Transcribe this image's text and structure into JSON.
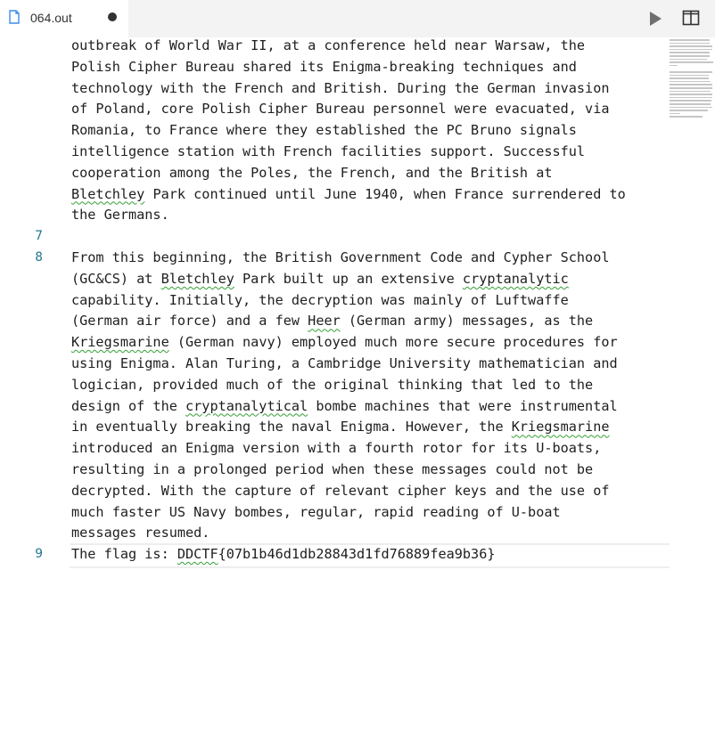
{
  "tab": {
    "filename": "064.out",
    "icon": "file-icon",
    "dirty_icon": "unsaved-dot-icon"
  },
  "toolbar": {
    "run_icon": "play-icon",
    "split_icon": "split-editor-icon"
  },
  "editor": {
    "lines": [
      {
        "number": "",
        "text": "outbreak of World War II, at a conference held near Warsaw, the"
      },
      {
        "number": "",
        "text": "Polish Cipher Bureau shared its Enigma-breaking techniques and"
      },
      {
        "number": "",
        "text": "technology with the French and British. During the German invasion"
      },
      {
        "number": "",
        "text": "of Poland, core Polish Cipher Bureau personnel were evacuated, via"
      },
      {
        "number": "",
        "text": "Romania, to France where they established the PC Bruno signals"
      },
      {
        "number": "",
        "text": "intelligence station with French facilities support. Successful"
      },
      {
        "number": "",
        "text": "cooperation among the Poles, the French, and the British at"
      },
      {
        "number": "",
        "text": "Bletchley Park continued until June 1940, when France surrendered to"
      },
      {
        "number": "",
        "text": "the Germans."
      },
      {
        "number": "7",
        "text": ""
      },
      {
        "number": "8",
        "text": "From this beginning, the British Government Code and Cypher School"
      },
      {
        "number": "",
        "text": "(GC&CS) at Bletchley Park built up an extensive cryptanalytic"
      },
      {
        "number": "",
        "text": "capability. Initially, the decryption was mainly of Luftwaffe"
      },
      {
        "number": "",
        "text": "(German air force) and a few Heer (German army) messages, as the"
      },
      {
        "number": "",
        "text": "Kriegsmarine (German navy) employed much more secure procedures for"
      },
      {
        "number": "",
        "text": "using Enigma. Alan Turing, a Cambridge University mathematician and"
      },
      {
        "number": "",
        "text": "logician, provided much of the original thinking that led to the"
      },
      {
        "number": "",
        "text": "design of the cryptanalytical bombe machines that were instrumental"
      },
      {
        "number": "",
        "text": "in eventually breaking the naval Enigma. However, the Kriegsmarine"
      },
      {
        "number": "",
        "text": "introduced an Enigma version with a fourth rotor for its U-boats,"
      },
      {
        "number": "",
        "text": "resulting in a prolonged period when these messages could not be"
      },
      {
        "number": "",
        "text": "decrypted. With the capture of relevant cipher keys and the use of"
      },
      {
        "number": "",
        "text": "much faster US Navy bombes, regular, rapid reading of U-boat"
      },
      {
        "number": "",
        "text": "messages resumed."
      },
      {
        "number": "9",
        "text": "The flag is: DDCTF{07b1b46d1db28843d1fd76889fea9b36}"
      }
    ],
    "squiggly_words": [
      "Bletchley",
      "cryptanalytic",
      "Heer",
      "Kriegsmarine",
      "cryptanalytical",
      "DDCTF"
    ]
  }
}
